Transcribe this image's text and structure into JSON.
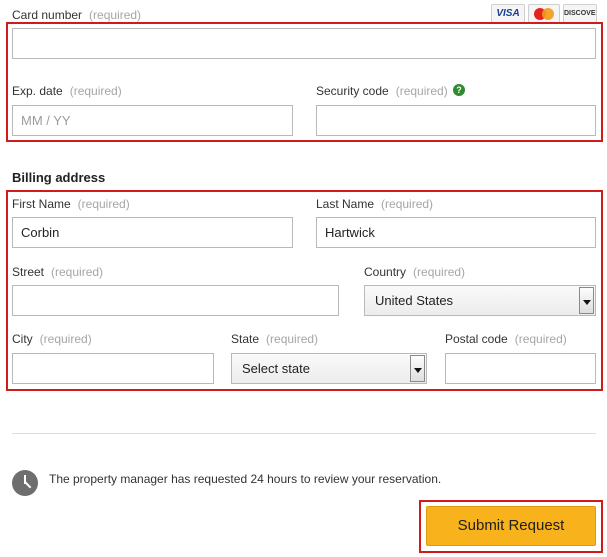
{
  "payment": {
    "card_number": {
      "label": "Card number",
      "required": "(required)",
      "value": ""
    },
    "card_brands": [
      "VISA",
      "MasterCard",
      "DISCOVER"
    ],
    "exp_date": {
      "label": "Exp. date",
      "required": "(required)",
      "placeholder": "MM / YY",
      "value": ""
    },
    "security_code": {
      "label": "Security code",
      "required": "(required)",
      "help_icon": "question-icon",
      "help_glyph": "?",
      "value": ""
    }
  },
  "billing": {
    "title": "Billing address",
    "first_name": {
      "label": "First Name",
      "required": "(required)",
      "value": "Corbin"
    },
    "last_name": {
      "label": "Last Name",
      "required": "(required)",
      "value": "Hartwick"
    },
    "street": {
      "label": "Street",
      "required": "(required)",
      "value": ""
    },
    "country": {
      "label": "Country",
      "required": "(required)",
      "value": "United States"
    },
    "city": {
      "label": "City",
      "required": "(required)",
      "value": ""
    },
    "state": {
      "label": "State",
      "required": "(required)",
      "value": "Select state"
    },
    "postal_code": {
      "label": "Postal code",
      "required": "(required)",
      "value": ""
    }
  },
  "notice": {
    "icon": "clock-icon",
    "text": "The property manager has requested 24 hours to review your reservation."
  },
  "submit": {
    "label": "Submit Request"
  },
  "colors": {
    "highlight_border": "#d11a1a",
    "button_bg": "#f8b21c",
    "help_icon": "#2e8b2e",
    "required_text": "#a6a6a6"
  }
}
